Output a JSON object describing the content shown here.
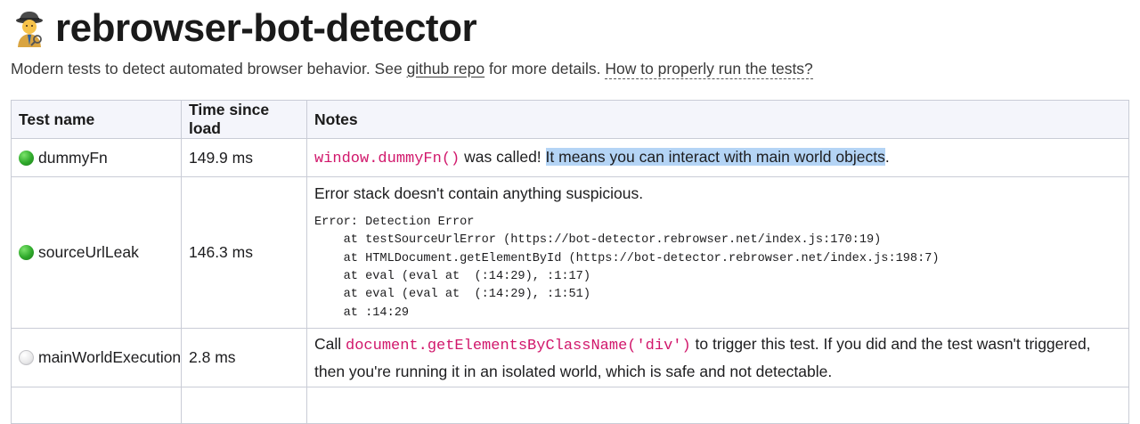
{
  "header": {
    "title": "rebrowser-bot-detector",
    "logo_icon": "detective-icon",
    "subtitle_before": "Modern tests to detect automated browser behavior. See ",
    "subtitle_link": "github repo",
    "subtitle_after": " for more details. ",
    "subtitle_help_link": "How to properly run the tests?"
  },
  "table": {
    "headers": [
      "Test name",
      "Time since load",
      "Notes"
    ],
    "rows": [
      {
        "status": "green",
        "name": "dummyFn",
        "time": "149.9 ms",
        "code": "window.dummyFn()",
        "text_after_code": " was called! ",
        "highlighted": "It means you can interact with main world objects",
        "trailing": "."
      },
      {
        "status": "green",
        "name": "sourceUrlLeak",
        "time": "146.3 ms",
        "note": "Error stack doesn't contain anything suspicious.",
        "stack": "Error: Detection Error\n    at testSourceUrlError (https://bot-detector.rebrowser.net/index.js:170:19)\n    at HTMLDocument.getElementById (https://bot-detector.rebrowser.net/index.js:198:7)\n    at eval (eval at  (:14:29), :1:17)\n    at eval (eval at  (:14:29), :1:51)\n    at :14:29"
      },
      {
        "status": "white",
        "name": "mainWorldExecution",
        "time": "2.8 ms",
        "text_before_code": "Call ",
        "code": "document.getElementsByClassName('div')",
        "text_after_code": " to trigger this test. If you did and the test wasn't triggered, then you're running it in an isolated world, which is safe and not detectable."
      }
    ]
  }
}
